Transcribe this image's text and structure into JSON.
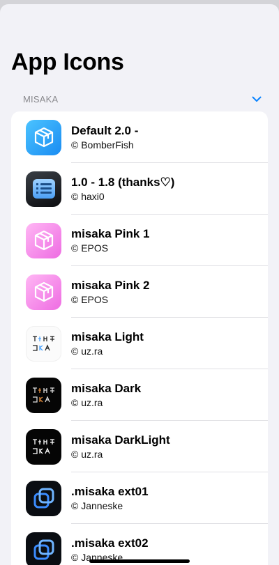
{
  "page": {
    "title": "App Icons"
  },
  "section": {
    "label": "MISAKA",
    "toggle_icon": "chevron-down-icon"
  },
  "colors": {
    "accent": "#0a84ff",
    "background": "#f2f2f7",
    "card": "#ffffff"
  },
  "icons": [
    {
      "title": "Default 2.0 -",
      "author": "© BomberFish",
      "style": "cube-blue"
    },
    {
      "title": "1.0 - 1.8 (thanks♡)",
      "author": "© haxi0",
      "style": "list-dark"
    },
    {
      "title": "misaka Pink 1",
      "author": "© EPOS",
      "style": "cube-pink"
    },
    {
      "title": "misaka Pink 2",
      "author": "© EPOS",
      "style": "cube-pink"
    },
    {
      "title": "misaka Light",
      "author": "© uz.ra",
      "style": "wordmark-light"
    },
    {
      "title": "misaka Dark",
      "author": "© uz.ra",
      "style": "wordmark-dark"
    },
    {
      "title": "misaka DarkLight",
      "author": "© uz.ra",
      "style": "wordmark-darklight"
    },
    {
      "title": ".misaka ext01",
      "author": "© Janneske",
      "style": "squares-neon"
    },
    {
      "title": ".misaka ext02",
      "author": "© Janneske",
      "style": "squares-neon"
    }
  ]
}
